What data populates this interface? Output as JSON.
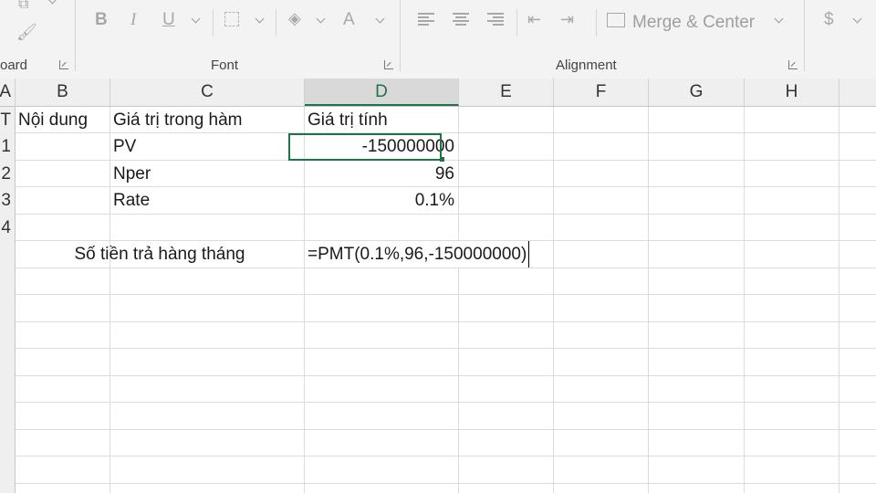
{
  "ribbon": {
    "groups": {
      "clipboard": "oard",
      "font": "Font",
      "alignment": "Alignment"
    },
    "font_buttons": {
      "bold": "B",
      "italic": "I",
      "underline": "U",
      "font_color": "A"
    },
    "merge_center": "Merge & Center",
    "currency": "$"
  },
  "columns": [
    "A",
    "B",
    "C",
    "D",
    "E",
    "F",
    "G",
    "H"
  ],
  "selected_column": "D",
  "rows": [
    "T",
    "1",
    "2",
    "3",
    "4"
  ],
  "cells": {
    "a1": "T",
    "b1": "Nội dung",
    "c1": "Giá trị trong hàm",
    "d1": "Giá trị tính",
    "a2": "1",
    "c2": "PV",
    "d2": "-150000000",
    "a3": "2",
    "c3": "Nper",
    "d3": "96",
    "a4": "3",
    "c4": "Rate",
    "d4": "0.1%",
    "a5": "4",
    "b6": "Số tiền trả hàng tháng",
    "d6": "=PMT(0.1%,96,-150000000)"
  }
}
